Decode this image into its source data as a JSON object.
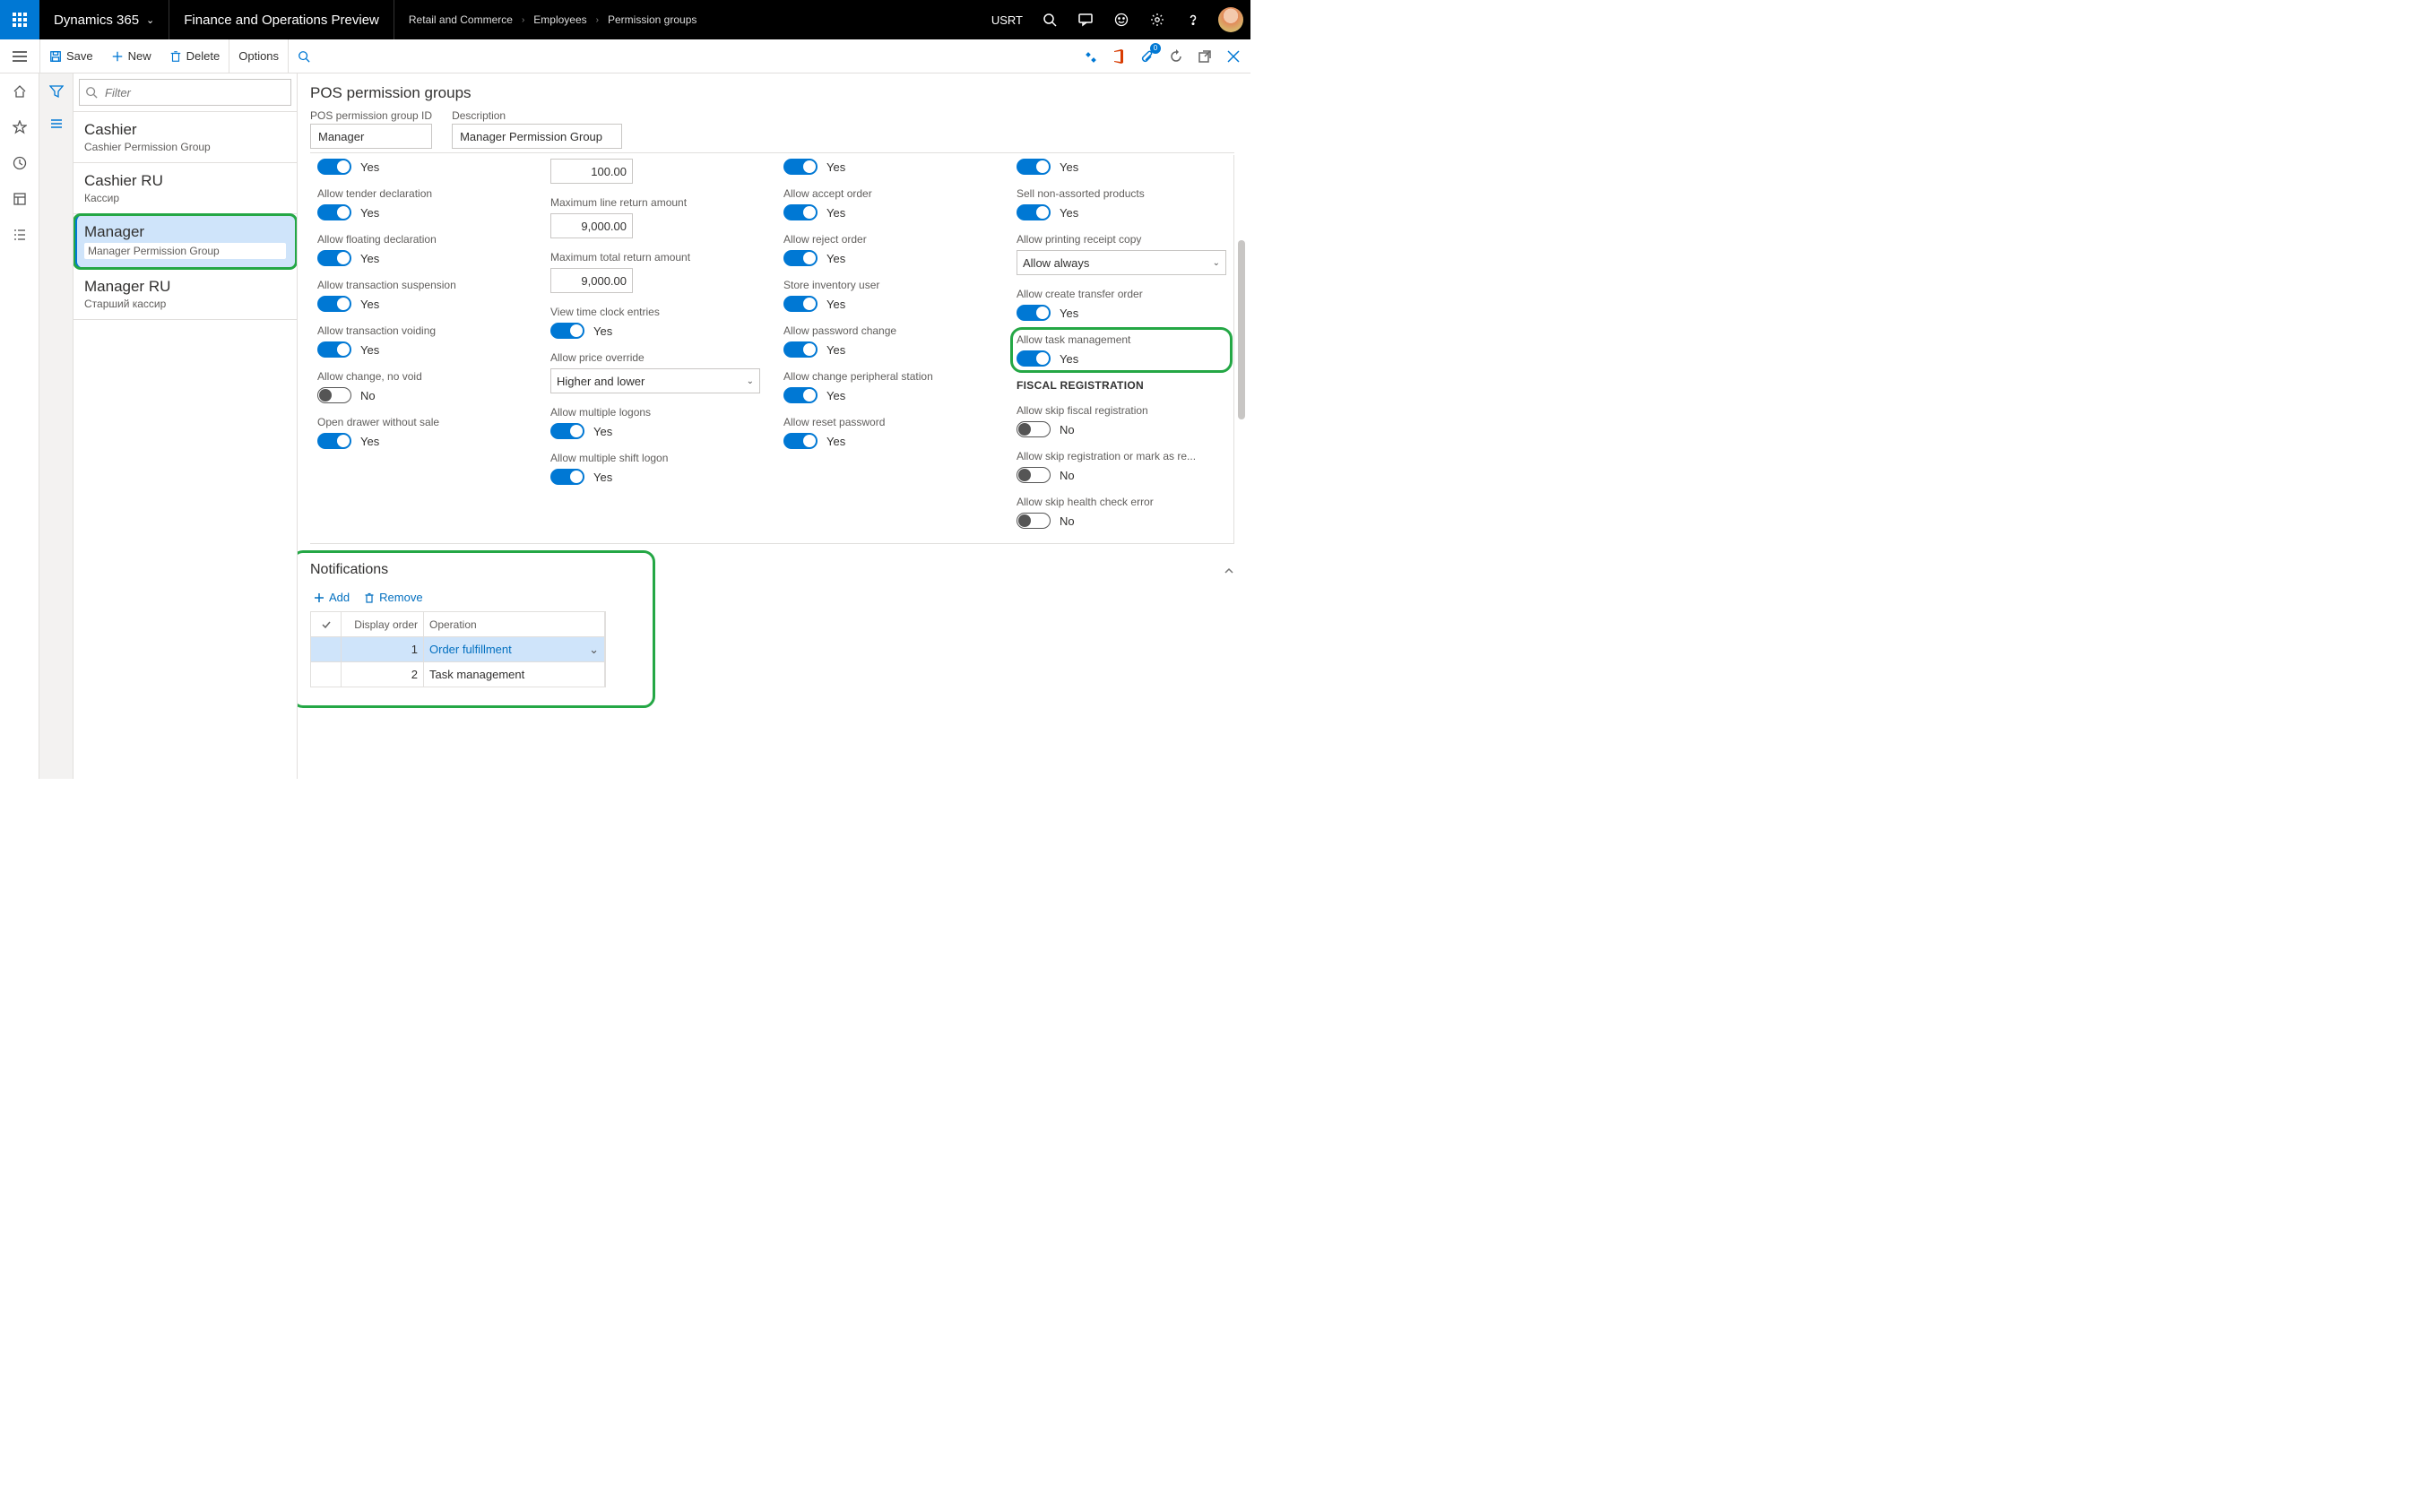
{
  "top": {
    "brand": "Dynamics 365",
    "module": "Finance and Operations Preview",
    "breadcrumb": [
      "Retail and Commerce",
      "Employees",
      "Permission groups"
    ],
    "company": "USRT",
    "notif_badge": "0"
  },
  "actions": {
    "save": "Save",
    "new": "New",
    "delete": "Delete",
    "options": "Options"
  },
  "filter_placeholder": "Filter",
  "list": [
    {
      "title": "Cashier",
      "sub": "Cashier Permission Group"
    },
    {
      "title": "Cashier RU",
      "sub": "Кассир"
    },
    {
      "title": "Manager",
      "sub": "Manager Permission Group",
      "selected": true
    },
    {
      "title": "Manager RU",
      "sub": "Старший кассир"
    }
  ],
  "page": {
    "title": "POS permission groups",
    "id_label": "POS permission group ID",
    "id_value": "Manager",
    "desc_label": "Description",
    "desc_value": "Manager Permission Group"
  },
  "cols": {
    "c1": [
      {
        "label": "",
        "type": "toggle",
        "value": "Yes"
      },
      {
        "label": "Allow tender declaration",
        "type": "toggle",
        "value": "Yes"
      },
      {
        "label": "Allow floating declaration",
        "type": "toggle",
        "value": "Yes"
      },
      {
        "label": "Allow transaction suspension",
        "type": "toggle",
        "value": "Yes"
      },
      {
        "label": "Allow transaction voiding",
        "type": "toggle",
        "value": "Yes"
      },
      {
        "label": "Allow change, no void",
        "type": "toggle",
        "value": "No"
      },
      {
        "label": "Open drawer without sale",
        "type": "toggle",
        "value": "Yes"
      }
    ],
    "c2": [
      {
        "label": "",
        "type": "number",
        "value": "100.00"
      },
      {
        "label": "Maximum line return amount",
        "type": "number",
        "value": "9,000.00"
      },
      {
        "label": "Maximum total return amount",
        "type": "number",
        "value": "9,000.00"
      },
      {
        "label": "View time clock entries",
        "type": "toggle",
        "value": "Yes"
      },
      {
        "label": "Allow price override",
        "type": "select",
        "value": "Higher and lower"
      },
      {
        "label": "Allow multiple logons",
        "type": "toggle",
        "value": "Yes"
      },
      {
        "label": "Allow multiple shift logon",
        "type": "toggle",
        "value": "Yes"
      }
    ],
    "c3": [
      {
        "label": "",
        "type": "toggle",
        "value": "Yes"
      },
      {
        "label": "Allow accept order",
        "type": "toggle",
        "value": "Yes"
      },
      {
        "label": "Allow reject order",
        "type": "toggle",
        "value": "Yes"
      },
      {
        "label": "Store inventory user",
        "type": "toggle",
        "value": "Yes"
      },
      {
        "label": "Allow password change",
        "type": "toggle",
        "value": "Yes"
      },
      {
        "label": "Allow change peripheral station",
        "type": "toggle",
        "value": "Yes"
      },
      {
        "label": "Allow reset password",
        "type": "toggle",
        "value": "Yes"
      }
    ],
    "c4": [
      {
        "label": "",
        "type": "toggle",
        "value": "Yes"
      },
      {
        "label": "Sell non-assorted products",
        "type": "toggle",
        "value": "Yes"
      },
      {
        "label": "Allow printing receipt copy",
        "type": "select",
        "value": "Allow always"
      },
      {
        "label": "Allow create transfer order",
        "type": "toggle",
        "value": "Yes"
      },
      {
        "label": "Allow task management",
        "type": "toggle",
        "value": "Yes",
        "highlight": true
      },
      {
        "label": "FISCAL REGISTRATION",
        "type": "section"
      },
      {
        "label": "Allow skip fiscal registration",
        "type": "toggle",
        "value": "No"
      },
      {
        "label": "Allow skip registration or mark as re...",
        "type": "toggle",
        "value": "No"
      },
      {
        "label": "Allow skip health check error",
        "type": "toggle",
        "value": "No"
      }
    ]
  },
  "notifications": {
    "title": "Notifications",
    "add": "Add",
    "remove": "Remove",
    "columns": {
      "check": "✓",
      "order": "Display order",
      "op": "Operation"
    },
    "rows": [
      {
        "order": "1",
        "op": "Order fulfillment",
        "selected": true
      },
      {
        "order": "2",
        "op": "Task management"
      }
    ]
  }
}
